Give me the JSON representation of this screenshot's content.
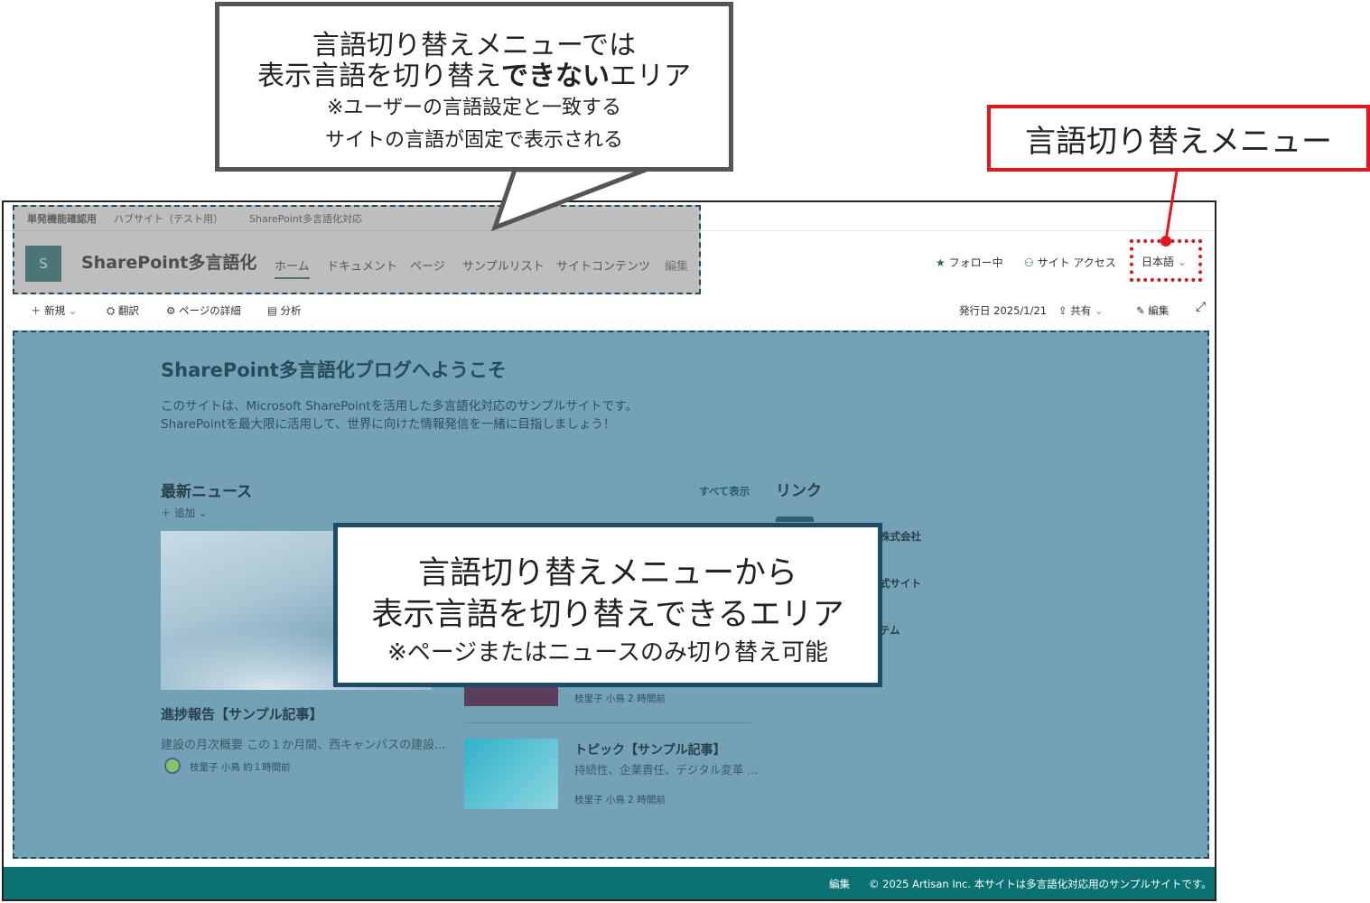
{
  "callout_top": {
    "line1": "言語切り替えメニューでは",
    "line2_pre": "表示言語を切り替え",
    "line2_bold": "できない",
    "line2_post": "エリア",
    "line3": "※ユーザーの言語設定と一致する",
    "line4": "サイトの言語が固定で表示される"
  },
  "callout_lang_menu": "言語切り替えメニュー",
  "callout_center": {
    "line1": "言語切り替えメニューから",
    "line2": "表示言語を切り替えできるエリア",
    "line3": "※ページまたはニュースのみ切り替え可能"
  },
  "hub": {
    "items": [
      "単発機能確認用",
      "ハブサイト（テスト用）",
      "SharePoint多言語化対応"
    ]
  },
  "site": {
    "logo_letter": "S",
    "title": "SharePoint多言語化",
    "nav": [
      "ホーム",
      "ドキュメント",
      "ページ",
      "サンプルリスト",
      "サイトコンテンツ",
      "編集"
    ],
    "follow": "フォロー中",
    "site_access": "サイト アクセス",
    "language": "日本語"
  },
  "commandbar": {
    "new": "新規",
    "translate": "翻訳",
    "page_details": "ページの詳細",
    "analytics": "分析",
    "published": "発行日 2025/1/21",
    "share": "共有",
    "edit": "編集"
  },
  "welcome": {
    "title": "SharePoint多言語化ブログへようこそ",
    "line1": "このサイトは、Microsoft SharePointを活用した多言語化対応のサンプルサイトです。",
    "line2": "SharePointを最大限に活用して、世界に向けた情報発信を一緒に目指しましょう！"
  },
  "news": {
    "title": "最新ニュース",
    "add": "追加",
    "see_all": "すべて表示",
    "items": [
      {
        "title": "進捗報告【サンプル記事】",
        "desc": "建設の月次概要 この１か月間、西キャンパスの建設...",
        "author": "枝里子 小鳥 約１時間前"
      },
      {
        "meta": "枝里子 小鳥 2 時間前"
      },
      {
        "title": "トピック【サンプル記事】",
        "desc": "持続性、企業責任、デジタル変革 ...",
        "author": "枝里子 小鳥 2 時間前"
      }
    ]
  },
  "links": {
    "title": "リンク",
    "fragments": [
      "株式会社",
      "式サイト",
      "テム"
    ]
  },
  "footer": {
    "edit": "編集",
    "copyright": "© 2025 Artisan Inc. 本サイトは多言語化対応用のサンプルサイトです。"
  },
  "colors": {
    "brand_teal": "#0a7272",
    "switchable_overlay": "#73a2b6",
    "callout_red": "#e8151b",
    "callout_border": "#555555"
  }
}
